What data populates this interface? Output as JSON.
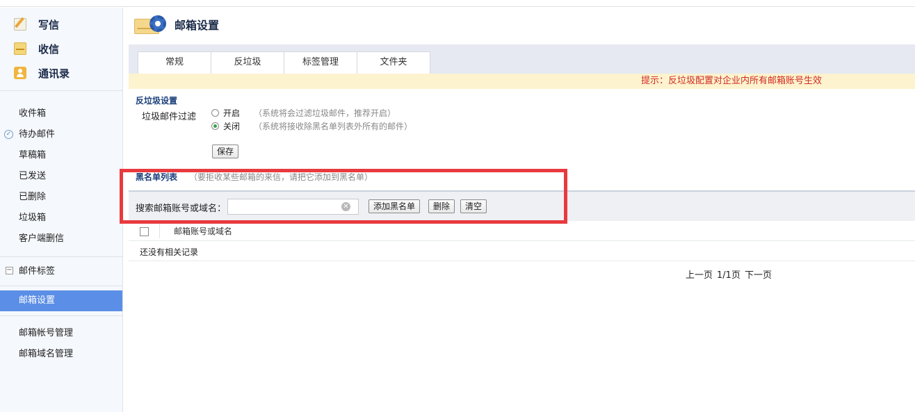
{
  "sidebar": {
    "quick": {
      "write": "写信",
      "receive": "收信",
      "contacts": "通讯录"
    },
    "folders": [
      "收件箱",
      "待办邮件",
      "草稿箱",
      "已发送",
      "已删除",
      "垃圾箱",
      "客户端删信"
    ],
    "tags": "邮件标签",
    "active": "邮箱设置",
    "admin": [
      "邮箱帐号管理",
      "邮箱域名管理"
    ]
  },
  "header": {
    "title": "邮箱设置"
  },
  "tabs": [
    "常规",
    "反垃圾",
    "标签管理",
    "文件夹"
  ],
  "hint": "提示：反垃圾配置对企业内所有邮箱账号生效",
  "antispam": {
    "title": "反垃圾设置",
    "filter_label": "垃圾邮件过滤",
    "on_label": "开启",
    "on_note": "（系统将会过滤垃圾邮件，推荐开启）",
    "off_label": "关闭",
    "off_note": "（系统将接收除黑名单列表外所有的邮件）",
    "selected": "off",
    "save": "保存"
  },
  "blacklist": {
    "title": "黑名单列表",
    "note": "（要拒收某些邮箱的来信，请把它添加到黑名单）",
    "search_label": "搜索邮箱账号或域名：",
    "search_value": "",
    "add": "添加黑名单",
    "delete": "删除",
    "clear": "清空",
    "column": "邮箱账号或域名",
    "empty": "还没有相关记录"
  },
  "pager": {
    "prev": "上一页",
    "info": "1/1页",
    "next": "下一页"
  },
  "colors": {
    "active": "#5b8ee6",
    "hint": "#d02b1f",
    "highlight": "#e83a3e"
  }
}
